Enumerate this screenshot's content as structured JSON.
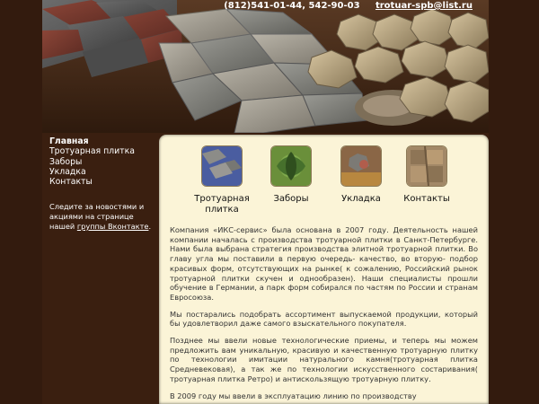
{
  "header": {
    "phones": "(812)541-01-44, 542-90-03",
    "email": "trotuar-spb@list.ru"
  },
  "sidebar": {
    "items": [
      {
        "label": "Главная",
        "active": true
      },
      {
        "label": "Тротуарная плитка",
        "active": false
      },
      {
        "label": "Заборы",
        "active": false
      },
      {
        "label": "Укладка",
        "active": false
      },
      {
        "label": "Контакты",
        "active": false
      }
    ],
    "news_text": "Следите за новостями и акциями на странице нашей",
    "news_link": "группы Вконтакте",
    "news_end": "."
  },
  "tiles": [
    {
      "label": "Тротуарная плитка",
      "image": "paving-thumb"
    },
    {
      "label": "Заборы",
      "image": "fence-thumb"
    },
    {
      "label": "Укладка",
      "image": "laying-thumb"
    },
    {
      "label": "Контакты",
      "image": "contacts-thumb"
    }
  ],
  "content": {
    "paragraphs": [
      "Компания «ИКС-сервис» была основана в 2007 году. Деятельность нашей компании началась с производства тротуарной плитки в Санкт-Петербурге. Нами была выбрана стратегия производства элитной тротуарной плитки. Во главу угла мы поставили в первую очередь- качество, во вторую- подбор красивых форм, отсутствующих на рынке( к сожалению, Российский рынок тротуарной плитки скучен и однообразен). Наши специалисты прошли обучение в Германии, а парк форм собирался по частям по России и странам Евросоюза.",
      "Мы постарались подобрать ассортимент выпускаемой продукции, который бы удовлетворил даже самого взыскательного покупателя.",
      "Позднее мы ввели новые технологические приемы, и теперь мы можем предложить вам уникальную, красивую и качественную тротуарную плитку по технологии имитации натурального камня(тротуарная плитка Средневековая), а так же по технологии искусственного состаривания( тротуарная плитка Ретро) и антискользящую тротуарную плитку.",
      "В 2009 году мы ввели в эксплуатацию линию по производству"
    ]
  }
}
